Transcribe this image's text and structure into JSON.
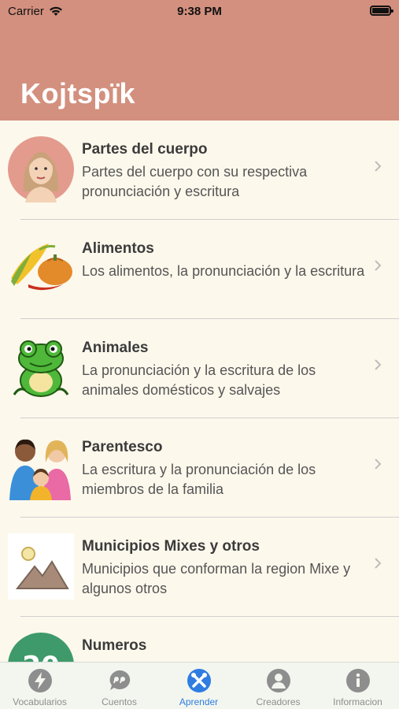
{
  "status_bar": {
    "carrier": "Carrier",
    "time": "9:38 PM"
  },
  "header": {
    "title": "Kojtspïk"
  },
  "list": {
    "items": [
      {
        "title": "Partes del cuerpo",
        "description": "Partes del cuerpo con su respectiva pronunciación y escritura",
        "icon": "woman-face-icon"
      },
      {
        "title": "Alimentos",
        "description": "Los alimentos, la pronunciación y la escritura",
        "icon": "corn-pumpkin-icon"
      },
      {
        "title": "Animales",
        "description": "La pronunciación y la escritura de los animales domésticos y salvajes",
        "icon": "frog-icon"
      },
      {
        "title": "Parentesco",
        "description": "La escritura y la pronunciación de los miembros de la familia",
        "icon": "family-icon"
      },
      {
        "title": "Municipios Mixes y otros",
        "description": "Municipios que conforman la region Mixe y algunos otros",
        "icon": "mountains-image-icon"
      },
      {
        "title": "Numeros",
        "description": "",
        "icon": "numbers-icon"
      }
    ]
  },
  "tabbar": {
    "tabs": [
      {
        "label": "Vocabularios",
        "icon": "bolt-icon"
      },
      {
        "label": "Cuentos",
        "icon": "quote-bubble-icon"
      },
      {
        "label": "Aprender",
        "icon": "tools-icon",
        "active": true
      },
      {
        "label": "Creadores",
        "icon": "person-icon"
      },
      {
        "label": "Informacion",
        "icon": "info-icon"
      }
    ]
  },
  "colors": {
    "header": "#d3907e",
    "background": "#fdf8ec",
    "active_tab": "#2f7de1",
    "inactive_tab": "#8e8e8e"
  }
}
